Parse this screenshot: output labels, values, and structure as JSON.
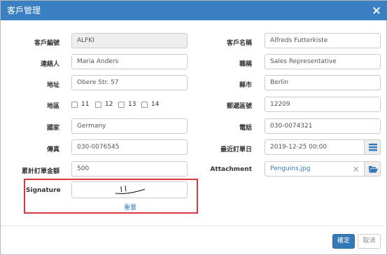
{
  "dialog": {
    "title": "客戶管理"
  },
  "fields": {
    "customer_id": {
      "label": "客戶編號",
      "value": "ALFKI"
    },
    "company_name": {
      "label": "客戶名稱",
      "value": "Alfreds Futterkiste"
    },
    "contact": {
      "label": "連絡人",
      "value": "Maria Anders"
    },
    "title": {
      "label": "職稱",
      "value": "Sales Representative"
    },
    "address": {
      "label": "地址",
      "value": "Obere Str. 57"
    },
    "city": {
      "label": "縣市",
      "value": "Berlin"
    },
    "region": {
      "label": "地區",
      "options": [
        "11",
        "12",
        "13",
        "14"
      ]
    },
    "postal_code": {
      "label": "郵遞區號",
      "value": "12209"
    },
    "country": {
      "label": "國家",
      "value": "Germany"
    },
    "phone": {
      "label": "電話",
      "value": "030-0074321"
    },
    "fax": {
      "label": "傳真",
      "value": "030-0076545"
    },
    "last_order_date": {
      "label": "最近訂單日",
      "value": "2019-12-25 00:00"
    },
    "total_order_amount": {
      "label": "累計訂單金額",
      "value": "500"
    },
    "attachment": {
      "label": "Attachment",
      "value": "Penguins.jpg"
    },
    "signature": {
      "label": "Signature",
      "reset_label": "重置"
    }
  },
  "footer": {
    "ok_label": "確定",
    "cancel_label": "取消"
  },
  "colors": {
    "titlebar": "#3a7fc1",
    "primary": "#337ab7",
    "highlight": "#d9363e"
  },
  "icons": {
    "close": "close-icon",
    "calendar": "list-icon",
    "folder": "folder-open-icon",
    "clear": "clear-icon"
  }
}
